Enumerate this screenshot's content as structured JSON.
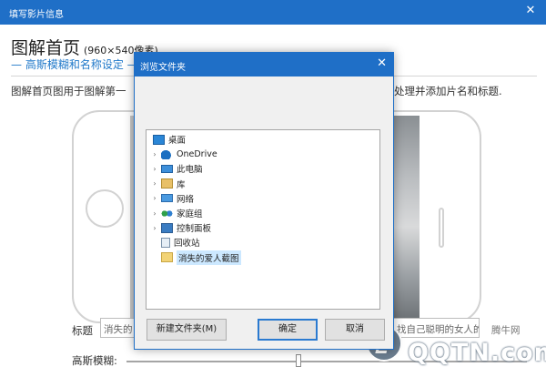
{
  "window": {
    "title": "填写影片信息",
    "close_glyph": "✕"
  },
  "page": {
    "title": "图解首页",
    "size": "(960×540像素)",
    "subtitle": "— 高斯模糊和名称设定 —",
    "description_left": "图解首页图用于图解第一",
    "description_right": "处理并添加片名和标题."
  },
  "form": {
    "title_label": "标题",
    "title_value_left": "消失的",
    "title_value_right": "找自己聪明的女人的",
    "blur_label": "高斯模糊:",
    "blur_level_percent": 43
  },
  "watermark": {
    "site_name": "腾牛网",
    "logo_text": "QQTN.com"
  },
  "dialog": {
    "title": "浏览文件夹",
    "close_glyph": "✕",
    "tree": [
      {
        "label": "桌面",
        "icon": "desktop-icon",
        "expandable": false,
        "indent": 0,
        "selected": false
      },
      {
        "label": "OneDrive",
        "icon": "onedrive-cloud-icon",
        "expandable": true,
        "indent": 1,
        "selected": false
      },
      {
        "label": "此电脑",
        "icon": "computer-icon",
        "expandable": true,
        "indent": 1,
        "selected": false
      },
      {
        "label": "库",
        "icon": "library-icon",
        "expandable": true,
        "indent": 1,
        "selected": false
      },
      {
        "label": "网络",
        "icon": "network-icon",
        "expandable": true,
        "indent": 1,
        "selected": false
      },
      {
        "label": "家庭组",
        "icon": "homegroup-icon",
        "expandable": true,
        "indent": 1,
        "selected": false
      },
      {
        "label": "控制面板",
        "icon": "control-panel-icon",
        "expandable": true,
        "indent": 1,
        "selected": false
      },
      {
        "label": "回收站",
        "icon": "recycle-bin-icon",
        "expandable": false,
        "indent": 1,
        "selected": false
      },
      {
        "label": "消失的爱人截图",
        "icon": "folder-icon",
        "expandable": false,
        "indent": 1,
        "selected": true
      }
    ],
    "new_folder_button": "新建文件夹(M)",
    "ok_button": "确定",
    "cancel_button": "取消"
  },
  "colors": {
    "accent": "#1f6fc7",
    "subtitle": "#1f78c9",
    "selection": "#cce8ff"
  }
}
